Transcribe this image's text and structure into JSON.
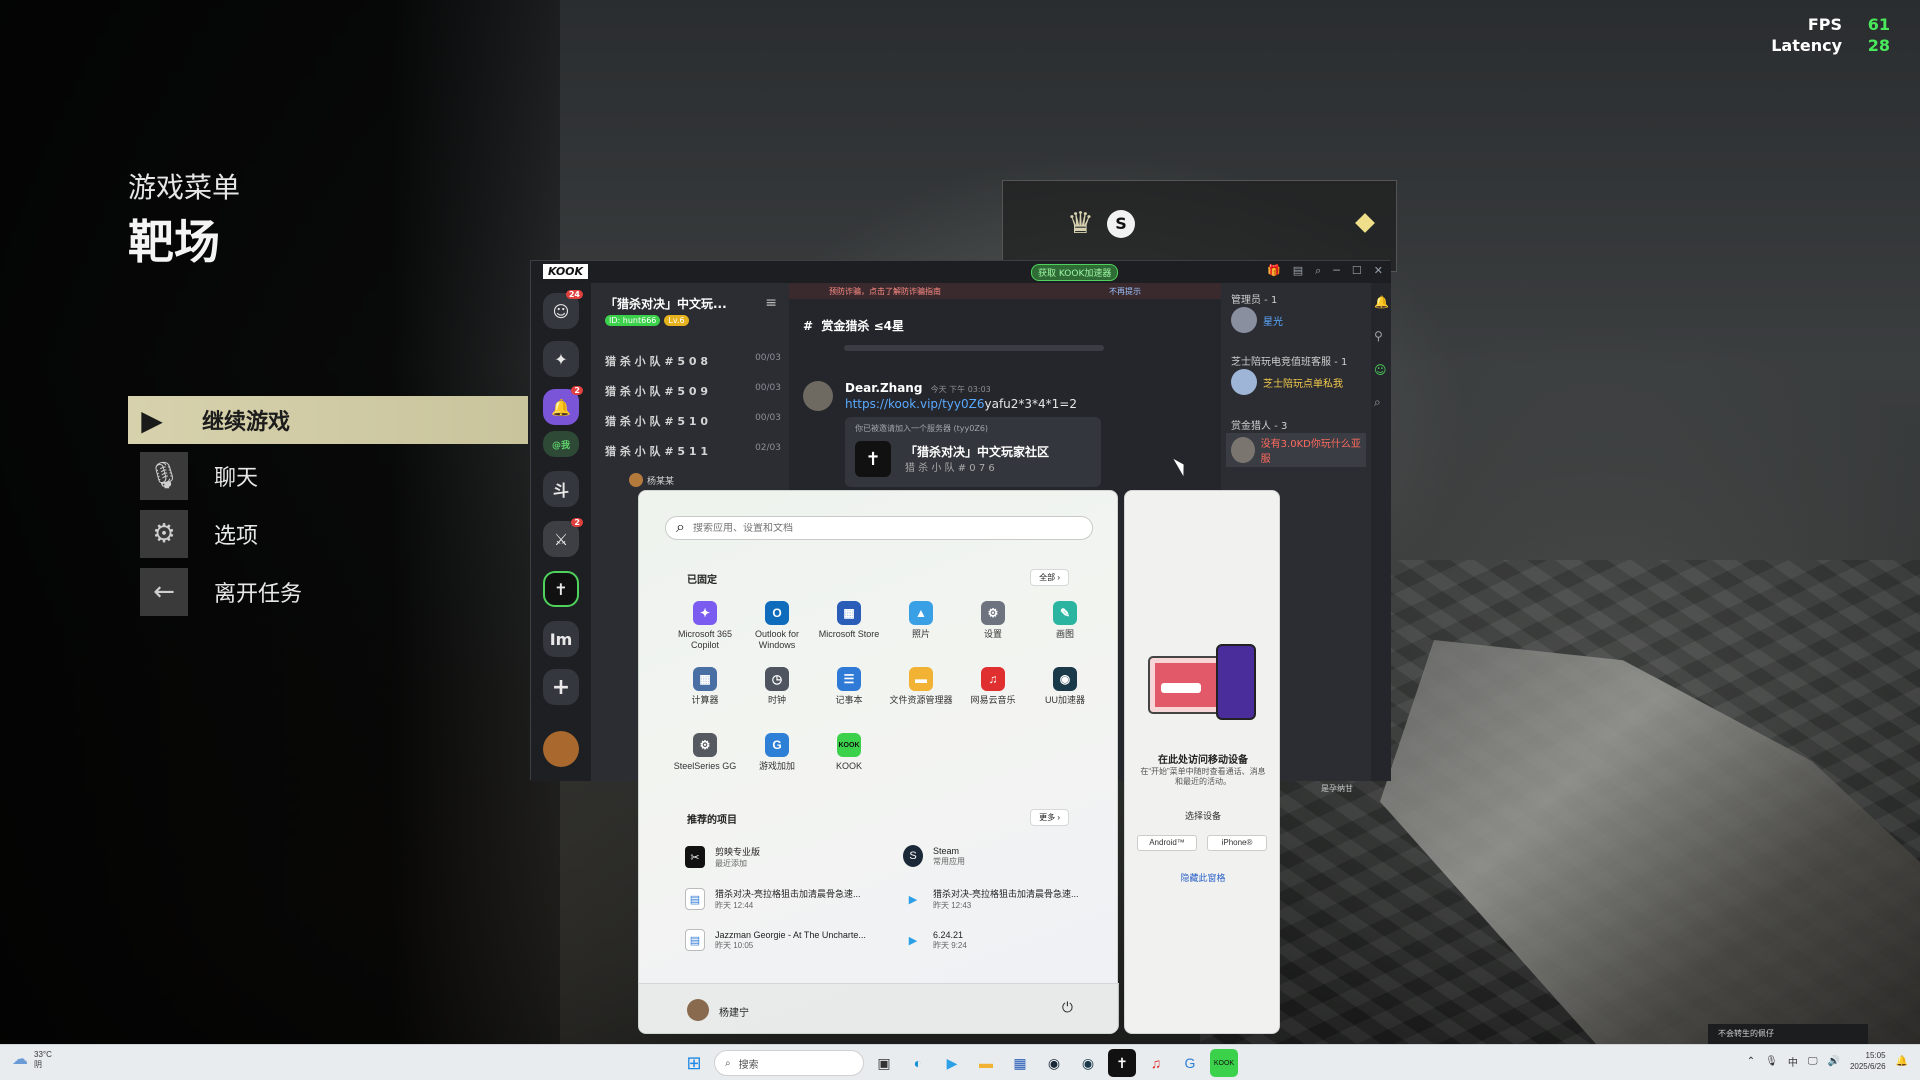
{
  "hud": {
    "fps_label": "FPS",
    "fps_value": "61",
    "latency_label": "Latency",
    "latency_value": "28"
  },
  "game_menu": {
    "subtitle": "游戏菜单",
    "title": "靶场",
    "items": [
      {
        "label": "继续游戏",
        "icon": "play-arrow-icon",
        "active": true
      },
      {
        "label": "聊天",
        "icon": "microphone-icon"
      },
      {
        "label": "选项",
        "icon": "gear-icon"
      },
      {
        "label": "离开任务",
        "icon": "arrow-left-icon"
      }
    ]
  },
  "kook": {
    "logo": "KOOK",
    "accel_button": "获取 KOOK加速器",
    "rail_badges": {
      "dm": "24",
      "bell": "2",
      "mod": "2"
    },
    "rail_labels": {
      "at": "@我",
      "im": "Im",
      "add": "+"
    },
    "server": {
      "name": "「猎杀对决」中文玩...",
      "id_badge": "ID: hunt666",
      "level_badge": "Lv.6"
    },
    "channels": [
      {
        "name": "猎 杀 小 队 # 5 0 8",
        "count": "00/03"
      },
      {
        "name": "猎 杀 小 队 # 5 0 9",
        "count": "00/03"
      },
      {
        "name": "猎 杀 小 队 # 5 1 0",
        "count": "00/03"
      },
      {
        "name": "猎 杀 小 队 # 5 1 1",
        "count": "02/03"
      }
    ],
    "voice_user": "杨某某",
    "notice": "预防诈骗，点击了解防诈骗指南",
    "notice_dismiss": "不再提示",
    "channel_title": "赏金猎杀 ≤4星",
    "message": {
      "author": "Dear.Zhang",
      "time": "今天 下午 03:03",
      "link": "https://kook.vip/tyy0Z6",
      "text": "yafu2*3*4*1=2",
      "invite_head": "你已被邀请加入一个服务器 (tyy0Z6)",
      "invite_name": "「猎杀对决」中文玩家社区",
      "invite_sub": "猎 杀 小 队 # 0 7 6"
    },
    "members": {
      "groups": [
        "管理员 - 1",
        "芝士陪玩电竞值班客服 - 1",
        "赏金猎人 - 3"
      ],
      "m1": "星光",
      "m2": "芝士陪玩点单私我",
      "m3": "没有3.0KD你玩什么亚服",
      "footer": "是孕纳甘"
    }
  },
  "start_menu": {
    "search_placeholder": "搜索应用、设置和文档",
    "pinned_label": "已固定",
    "all_button": "全部",
    "apps": [
      {
        "label": "Microsoft 365 Copilot",
        "icon": "copilot-icon",
        "color": "#7b5cf0"
      },
      {
        "label": "Outlook for Windows",
        "icon": "outlook-icon",
        "color": "#0f6cbd"
      },
      {
        "label": "Microsoft Store",
        "icon": "store-icon",
        "color": "#2a5db8"
      },
      {
        "label": "照片",
        "icon": "photos-icon",
        "color": "#3aa0e6"
      },
      {
        "label": "设置",
        "icon": "gear-icon",
        "color": "#6d7480"
      },
      {
        "label": "画图",
        "icon": "paint-icon",
        "color": "#2bb5a0"
      },
      {
        "label": "计算器",
        "icon": "calculator-icon",
        "color": "#4a6fa5"
      },
      {
        "label": "时钟",
        "icon": "clock-icon",
        "color": "#4f5560"
      },
      {
        "label": "记事本",
        "icon": "notepad-icon",
        "color": "#2f7ad6"
      },
      {
        "label": "文件资源管理器",
        "icon": "folder-icon",
        "color": "#f2b233"
      },
      {
        "label": "网易云音乐",
        "icon": "netease-music-icon",
        "color": "#e02f2f"
      },
      {
        "label": "UU加速器",
        "icon": "uu-icon",
        "color": "#1a3a4a"
      },
      {
        "label": "SteelSeries GG",
        "icon": "steelseries-icon",
        "color": "#555a60"
      },
      {
        "label": "游戏加加",
        "icon": "gameplus-icon",
        "color": "#2e7fd6"
      },
      {
        "label": "KOOK",
        "icon": "kook-icon",
        "color": "#3bd14a"
      }
    ],
    "recommended_label": "推荐的项目",
    "more_button": "更多",
    "recommended": [
      {
        "title": "剪映专业版",
        "sub": "最近添加",
        "icon": "capcut-icon"
      },
      {
        "title": "Steam",
        "sub": "常用应用",
        "icon": "steam-icon"
      },
      {
        "title": "猎杀对决-亮拉格狙击加清晨骨急速...",
        "sub": "昨天 12:44",
        "icon": "doc-icon"
      },
      {
        "title": "猎杀对决-亮拉格狙击加清晨骨急速...",
        "sub": "昨天 12:43",
        "icon": "media-icon"
      },
      {
        "title": "Jazzman Georgie - At The Uncharte...",
        "sub": "昨天 10:05",
        "icon": "doc-icon"
      },
      {
        "title": "6.24.21",
        "sub": "昨天 9:24",
        "icon": "media-icon"
      }
    ],
    "user_name": "杨建宁"
  },
  "phone_link": {
    "title": "在此处访问移动设备",
    "desc": "在“开始”菜单中随时查看通话、消息和最近的活动。",
    "choose": "选择设备",
    "android": "Android™",
    "iphone": "iPhone®",
    "hide": "隐藏此窗格"
  },
  "taskbar": {
    "temp": "33°C",
    "weather": "阴",
    "search": "搜索",
    "ime": "中",
    "time": "15:05",
    "date": "2025/6/26"
  },
  "toast": "不会转生的佩仔"
}
